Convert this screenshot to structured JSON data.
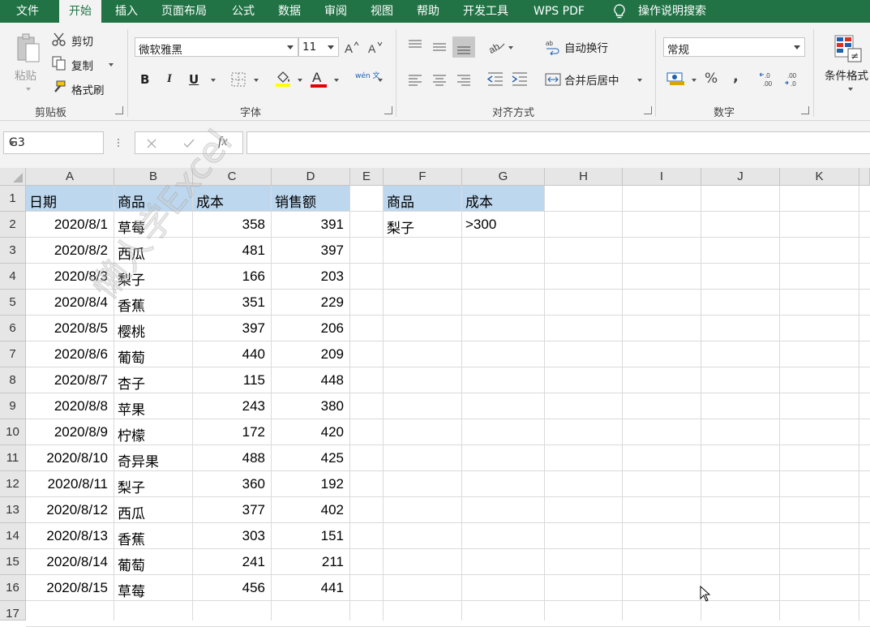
{
  "tabs": [
    "文件",
    "开始",
    "插入",
    "页面布局",
    "公式",
    "数据",
    "审阅",
    "视图",
    "帮助",
    "开发工具",
    "WPS PDF",
    "操作说明搜索"
  ],
  "active_tab": "开始",
  "clipboard": {
    "paste": "粘贴",
    "cut": "剪切",
    "copy": "复制",
    "format_painter": "格式刷",
    "group_label": "剪贴板"
  },
  "font": {
    "name": "微软雅黑",
    "size": "11",
    "bold": "B",
    "italic": "I",
    "underline": "U",
    "group_label": "字体",
    "phonetic": "wén 文"
  },
  "alignment": {
    "wrap_text": "自动换行",
    "merge_center": "合并后居中",
    "group_label": "对齐方式"
  },
  "number": {
    "format": "常规",
    "percent": "%",
    "comma": ",",
    "inc_dec": "←.0 .00",
    "dec_dec": ".00 →.0",
    "group_label": "数字"
  },
  "styles": {
    "conditional_format": "条件格式"
  },
  "formula_bar": {
    "name_box": "G3",
    "fx": "fx",
    "formula": ""
  },
  "columns": [
    "A",
    "B",
    "C",
    "D",
    "E",
    "F",
    "G",
    "H",
    "I",
    "J",
    "K"
  ],
  "rows": [
    "1",
    "2",
    "3",
    "4",
    "5",
    "6",
    "7",
    "8",
    "9",
    "10",
    "11",
    "12",
    "13",
    "14",
    "15",
    "16",
    "17"
  ],
  "table": {
    "headers": [
      "日期",
      "商品",
      "成本",
      "销售额"
    ],
    "rows": [
      [
        "2020/8/1",
        "草莓",
        "358",
        "391"
      ],
      [
        "2020/8/2",
        "西瓜",
        "481",
        "397"
      ],
      [
        "2020/8/3",
        "梨子",
        "166",
        "203"
      ],
      [
        "2020/8/4",
        "香蕉",
        "351",
        "229"
      ],
      [
        "2020/8/5",
        "樱桃",
        "397",
        "206"
      ],
      [
        "2020/8/6",
        "葡萄",
        "440",
        "209"
      ],
      [
        "2020/8/7",
        "杏子",
        "115",
        "448"
      ],
      [
        "2020/8/8",
        "苹果",
        "243",
        "380"
      ],
      [
        "2020/8/9",
        "柠檬",
        "172",
        "420"
      ],
      [
        "2020/8/10",
        "奇异果",
        "488",
        "425"
      ],
      [
        "2020/8/11",
        "梨子",
        "360",
        "192"
      ],
      [
        "2020/8/12",
        " 西瓜",
        "377",
        "402"
      ],
      [
        "2020/8/13",
        " 香蕉",
        "303",
        "151"
      ],
      [
        "2020/8/14",
        " 葡萄",
        "241",
        "211"
      ],
      [
        "2020/8/15",
        " 草莓",
        "456",
        "441"
      ]
    ]
  },
  "criteria": {
    "headers": [
      "商品",
      "成本"
    ],
    "values": [
      "梨子",
      ">300"
    ]
  },
  "watermark": "懒人学Excel",
  "colors": {
    "ribbon_green": "#217346",
    "header_fill": "#bdd7ee"
  }
}
